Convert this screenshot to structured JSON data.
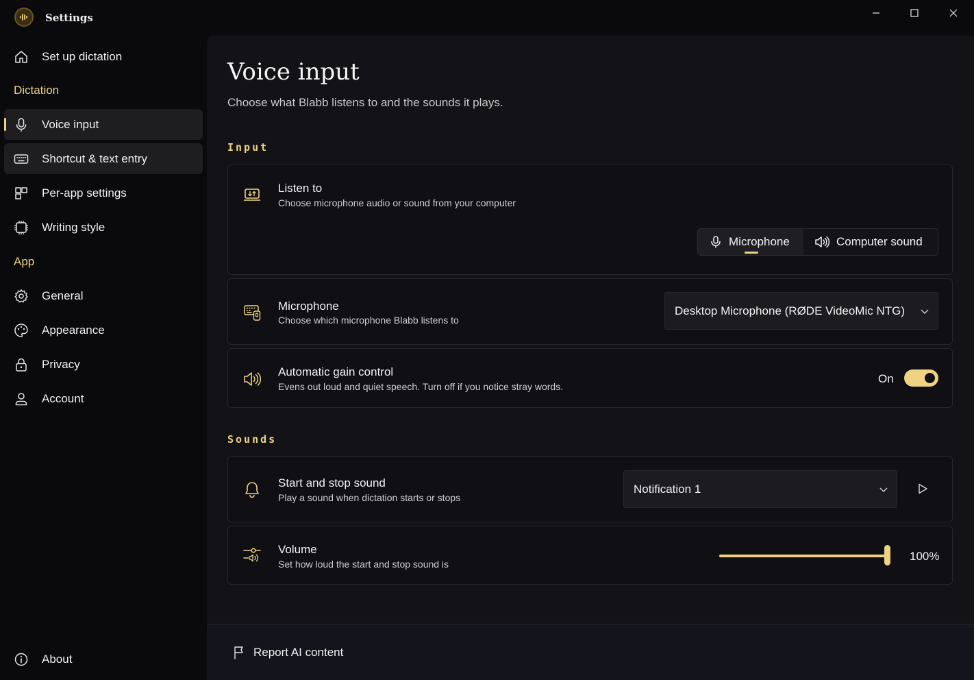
{
  "window": {
    "title": "Settings"
  },
  "sidebar": {
    "setup_label": "Set up dictation",
    "dictation_section": "Dictation",
    "app_section": "App",
    "items": [
      {
        "label": "Voice input",
        "icon": "microphone-icon",
        "selected": true
      },
      {
        "label": "Shortcut & text entry",
        "icon": "keyboard-icon"
      },
      {
        "label": "Per-app settings",
        "icon": "app-grid-icon"
      },
      {
        "label": "Writing style",
        "icon": "chip-icon"
      },
      {
        "label": "General",
        "icon": "gear-icon"
      },
      {
        "label": "Appearance",
        "icon": "palette-icon"
      },
      {
        "label": "Privacy",
        "icon": "lock-icon"
      },
      {
        "label": "Account",
        "icon": "person-icon"
      }
    ],
    "about_label": "About"
  },
  "page": {
    "title": "Voice input",
    "subtitle": "Choose what Blabb listens to and the sounds it plays."
  },
  "input_section": {
    "heading": "Input",
    "listen_to": {
      "title": "Listen to",
      "description": "Choose microphone audio or sound from your computer",
      "options": [
        "Microphone",
        "Computer sound"
      ],
      "selected": "Microphone"
    },
    "microphone": {
      "title": "Microphone",
      "description": "Choose which microphone Blabb listens to",
      "selected": "Desktop Microphone (RØDE VideoMic NTG)"
    },
    "agc": {
      "title": "Automatic gain control",
      "description": "Evens out loud and quiet speech. Turn off if you notice stray words.",
      "state_label": "On",
      "enabled": true
    }
  },
  "sounds_section": {
    "heading": "Sounds",
    "start_stop": {
      "title": "Start and stop sound",
      "description": "Play a sound when dictation starts or stops",
      "selected": "Notification 1"
    },
    "volume": {
      "title": "Volume",
      "description": "Set how loud the start and stop sound is",
      "value_label": "100%",
      "value": 100
    }
  },
  "footer": {
    "report_label": "Report AI content"
  },
  "colors": {
    "accent": "#f0d283",
    "background": "#0a0a0c",
    "panel": "#131317",
    "card": "#101014"
  }
}
